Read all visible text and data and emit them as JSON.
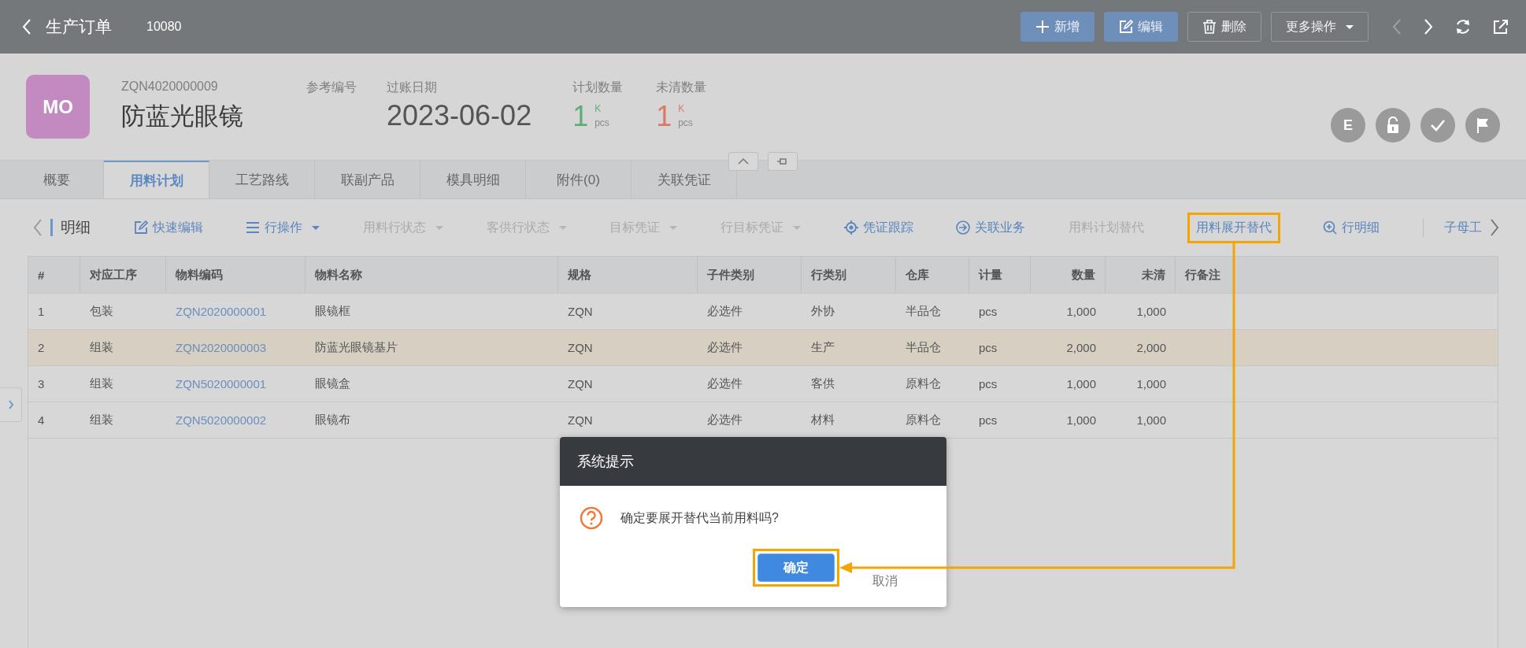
{
  "top_bar": {
    "title": "生产订单",
    "number": "10080",
    "buttons": [
      {
        "label": "新增",
        "kind": "add"
      },
      {
        "label": "编辑",
        "kind": "edit"
      },
      {
        "label": "删除",
        "kind": "delete"
      },
      {
        "label": "更多操作",
        "kind": "menu"
      }
    ],
    "pager": {
      "prev_disabled": true,
      "next_disabled": false
    }
  },
  "record": {
    "avatar": "MO",
    "code": "ZQN4020000009",
    "name": "防蓝光眼镜",
    "reference_label": "参考编号",
    "date_label": "过账日期",
    "date": "2023-06-02",
    "quantities": [
      {
        "label": "计划数量",
        "value": "1",
        "unit": "K",
        "uom": "pcs",
        "color": "#5fae7a"
      },
      {
        "label": "未清数量",
        "value": "1",
        "unit": "K",
        "uom": "pcs",
        "color": "#d97a66"
      }
    ],
    "status_badge": "E"
  },
  "tabs": [
    {
      "label": "概要",
      "selected": false
    },
    {
      "label": "用料计划",
      "selected": true
    },
    {
      "label": "工艺路线",
      "selected": false
    },
    {
      "label": "联副产品",
      "selected": false
    },
    {
      "label": "模具明细",
      "selected": false
    },
    {
      "label": "附件(0)",
      "selected": false
    },
    {
      "label": "关联凭证",
      "selected": false
    }
  ],
  "toolbar": {
    "title": "明细",
    "items": [
      {
        "label": "快速编辑",
        "kind": "edit",
        "disabled": false,
        "highlighted": false
      },
      {
        "label": "行操作",
        "kind": "menu",
        "disabled": false,
        "highlighted": false
      },
      {
        "label": "用料行状态",
        "kind": "dropdown",
        "disabled": true,
        "highlighted": false
      },
      {
        "label": "客供行状态",
        "kind": "dropdown",
        "disabled": true,
        "highlighted": false
      },
      {
        "label": "目标凭证",
        "kind": "dropdown",
        "disabled": true,
        "highlighted": false
      },
      {
        "label": "行目标凭证",
        "kind": "dropdown",
        "disabled": true,
        "highlighted": false
      },
      {
        "label": "凭证跟踪",
        "kind": "target",
        "disabled": false,
        "highlighted": false
      },
      {
        "label": "关联业务",
        "kind": "link",
        "disabled": false,
        "highlighted": false
      },
      {
        "label": "用料计划替代",
        "kind": "plain",
        "disabled": true,
        "highlighted": false
      },
      {
        "label": "用料展开替代",
        "kind": "plain",
        "disabled": false,
        "highlighted": true
      },
      {
        "label": "行明细",
        "kind": "zoom",
        "disabled": false,
        "highlighted": false
      },
      {
        "label": "子母工",
        "kind": "separated",
        "disabled": false,
        "highlighted": false
      }
    ]
  },
  "table": {
    "columns": [
      {
        "label": "#",
        "kind": "text"
      },
      {
        "label": "对应工序",
        "kind": "text"
      },
      {
        "label": "物料编码",
        "kind": "link"
      },
      {
        "label": "物料名称",
        "kind": "text"
      },
      {
        "label": "规格",
        "kind": "text"
      },
      {
        "label": "子件类别",
        "kind": "text"
      },
      {
        "label": "行类别",
        "kind": "text"
      },
      {
        "label": "仓库",
        "kind": "text"
      },
      {
        "label": "计量",
        "kind": "text"
      },
      {
        "label": "数量",
        "kind": "number"
      },
      {
        "label": "未清",
        "kind": "number"
      },
      {
        "label": "行备注",
        "kind": "text"
      }
    ],
    "rows": [
      {
        "selected": false,
        "cells": [
          "1",
          "包装",
          "ZQN2020000001",
          "眼镜框",
          "ZQN",
          "必选件",
          "外协",
          "半品仓",
          "pcs",
          "1,000",
          "1,000"
        ]
      },
      {
        "selected": true,
        "cells": [
          "2",
          "组装",
          "ZQN2020000003",
          "防蓝光眼镜基片",
          "ZQN",
          "必选件",
          "生产",
          "半品仓",
          "pcs",
          "2,000",
          "2,000"
        ]
      },
      {
        "selected": false,
        "cells": [
          "3",
          "组装",
          "ZQN5020000001",
          "眼镜盒",
          "ZQN",
          "必选件",
          "客供",
          "原料仓",
          "pcs",
          "1,000",
          "1,000"
        ]
      },
      {
        "selected": false,
        "cells": [
          "4",
          "组装",
          "ZQN5020000002",
          "眼镜布",
          "ZQN",
          "必选件",
          "材料",
          "原料仓",
          "pcs",
          "1,000",
          "1,000"
        ]
      }
    ]
  },
  "dialog": {
    "title": "系统提示",
    "message": "确定要展开替代当前用料吗?",
    "confirm": {
      "label": "确定",
      "highlighted": true
    },
    "cancel": "取消"
  }
}
